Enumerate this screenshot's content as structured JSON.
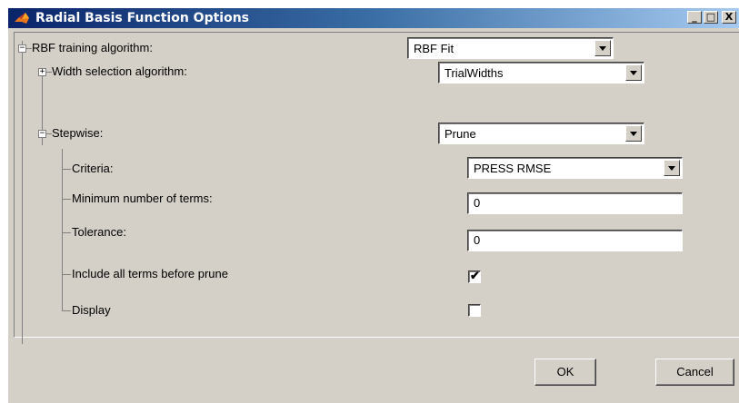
{
  "window": {
    "title": "Radial Basis Function Options",
    "minimize_label": "_",
    "maximize_label": "□",
    "close_label": "X"
  },
  "tree": {
    "rbf": {
      "label": "RBF training algorithm:",
      "expander": "−",
      "value": "RBF Fit"
    },
    "width": {
      "label": "Width selection algorithm:",
      "expander": "+",
      "value": "TrialWidths"
    },
    "stepwise": {
      "label": "Stepwise:",
      "expander": "−",
      "value": "Prune"
    },
    "criteria": {
      "label": "Criteria:",
      "value": "PRESS RMSE"
    },
    "min_terms": {
      "label": "Minimum number of terms:",
      "value": "0"
    },
    "tolerance": {
      "label": "Tolerance:",
      "value": "0"
    },
    "include_all": {
      "label": "Include all terms before prune",
      "checked": true,
      "mark": "✔"
    },
    "display": {
      "label": "Display",
      "checked": false
    }
  },
  "buttons": {
    "ok": "OK",
    "cancel": "Cancel"
  }
}
